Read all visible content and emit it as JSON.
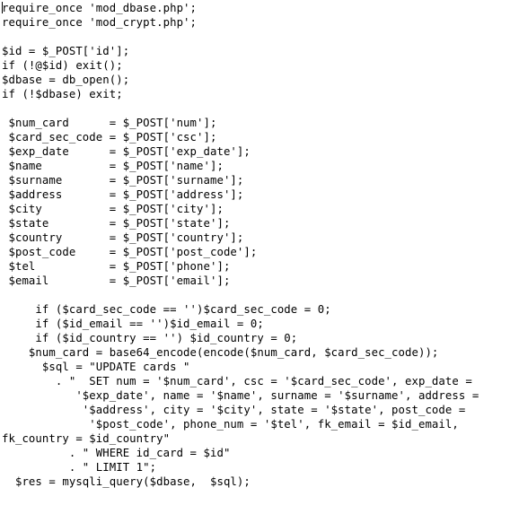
{
  "document": {
    "type": "source-code-listing",
    "language": "PHP",
    "background_color": "#ffffff",
    "text_color": "#000000",
    "caret": {
      "name": "text-caret",
      "line": 1,
      "column": 0
    },
    "code_lines": [
      "require_once 'mod_dbase.php';",
      "require_once 'mod_crypt.php';",
      "",
      "$id = $_POST['id'];",
      "if (!@$id) exit();",
      "$dbase = db_open();",
      "if (!$dbase) exit;",
      "",
      " $num_card      = $_POST['num'];",
      " $card_sec_code = $_POST['csc'];",
      " $exp_date      = $_POST['exp_date'];",
      " $name          = $_POST['name'];",
      " $surname       = $_POST['surname'];",
      " $address       = $_POST['address'];",
      " $city          = $_POST['city'];",
      " $state         = $_POST['state'];",
      " $country       = $_POST['country'];",
      " $post_code     = $_POST['post_code'];",
      " $tel           = $_POST['phone'];",
      " $email         = $_POST['email'];",
      "",
      "     if ($card_sec_code == '')$card_sec_code = 0;",
      "     if ($id_email == '')$id_email = 0;",
      "     if ($id_country == '') $id_country = 0;",
      "    $num_card = base64_encode(encode($num_card, $card_sec_code));",
      "      $sql = \"UPDATE cards \"",
      "        . \"  SET num = '$num_card', csc = '$card_sec_code', exp_date =",
      "           '$exp_date', name = '$name', surname = '$surname', address =",
      "            '$address', city = '$city', state = '$state', post_code =",
      "             '$post_code', phone_num = '$tel', fk_email = $id_email,",
      "fk_country = $id_country\"",
      "          . \" WHERE id_card = $id\"",
      "          . \" LIMIT 1\";",
      "  $res = mysqli_query($dbase,  $sql);"
    ]
  }
}
